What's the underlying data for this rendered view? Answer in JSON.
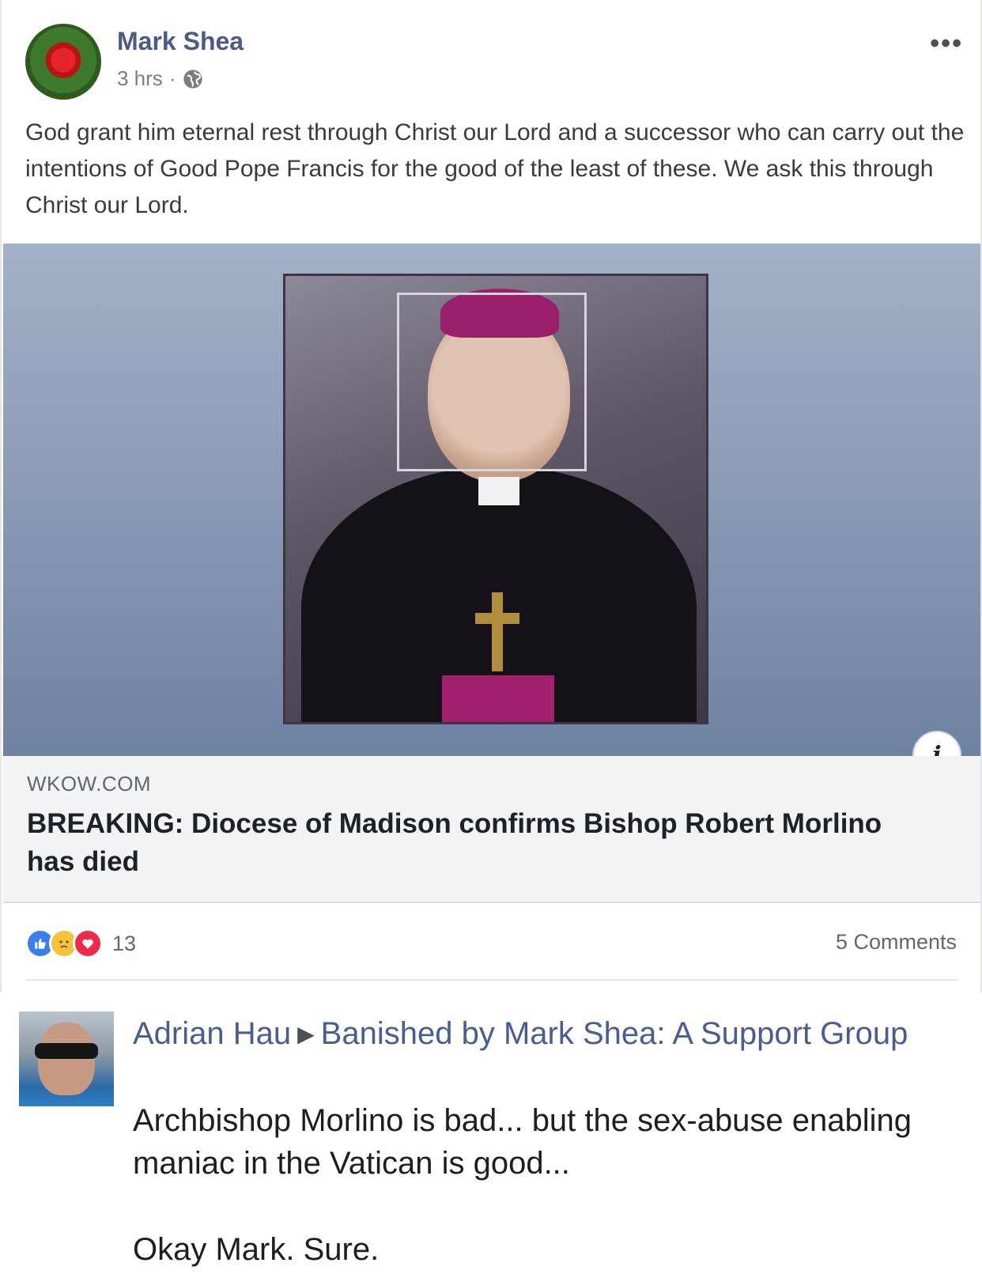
{
  "post": {
    "author": "Mark Shea",
    "time": "3 hrs",
    "separator": "·",
    "text": "God grant him eternal rest through Christ our Lord and a successor who can carry out the intentions of Good Pope Francis for the good of the least of these. We ask this through Christ our Lord.",
    "more_label": "•••"
  },
  "link": {
    "domain": "WKOW.COM",
    "headline": "BREAKING: Diocese of Madison confirms Bishop Robert Morlino has died",
    "info_label": "i"
  },
  "reactions": {
    "count": "13",
    "icons": [
      "like-icon",
      "sad-icon",
      "love-icon"
    ],
    "comments": "5 Comments"
  },
  "comment": {
    "author": "Adrian Hau",
    "arrow": "▶",
    "group": "Banished by Mark Shea: A Support Group",
    "text": "Archbishop Morlino is bad... but the sex-abuse enabling maniac in the Vatican is good...",
    "text2": "Okay Mark. Sure."
  },
  "colors": {
    "author_link": "#4b5a86",
    "comment_link": "#4b5d8f",
    "like": "#3b7de9",
    "love": "#f0284a"
  }
}
